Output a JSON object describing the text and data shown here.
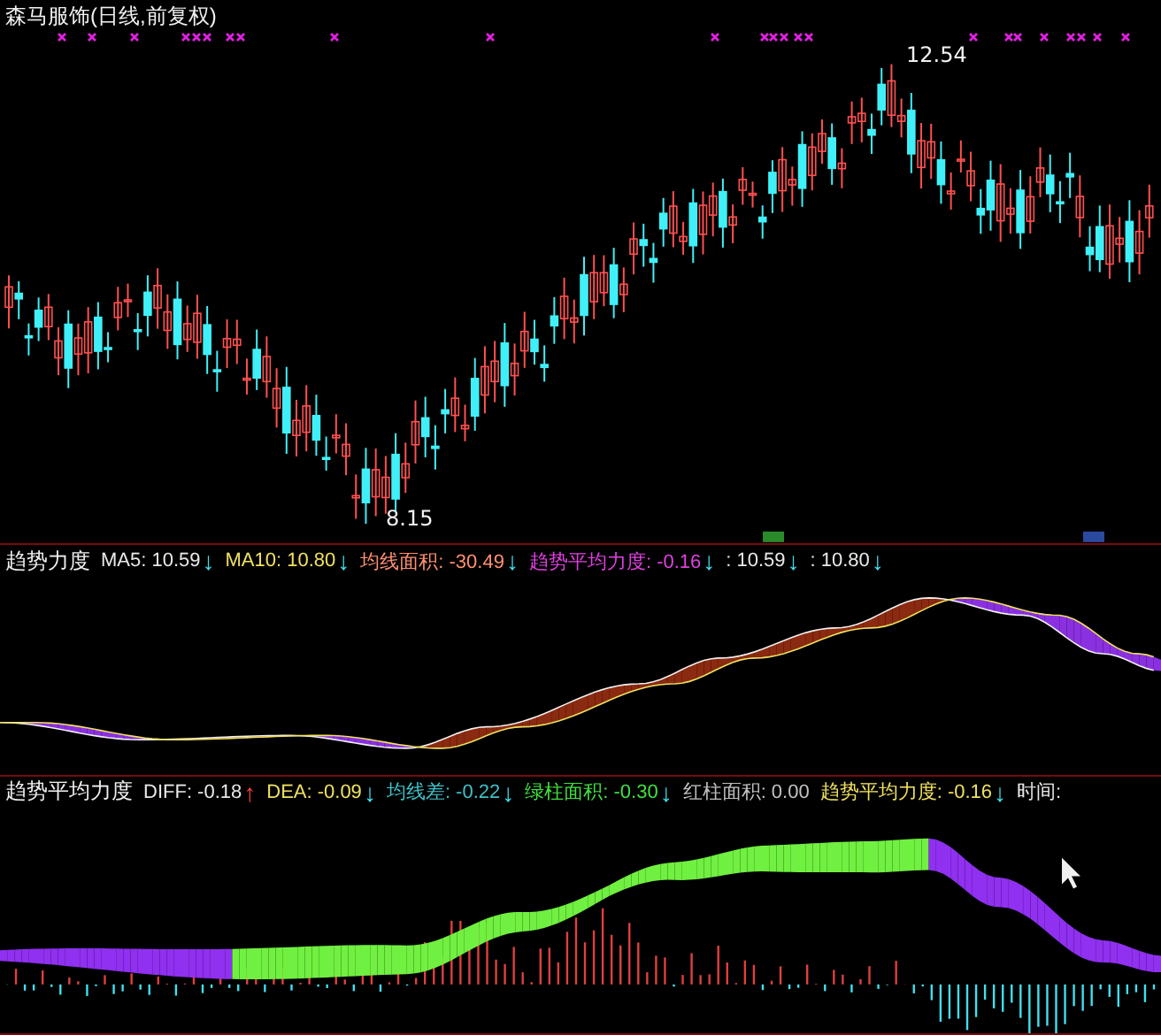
{
  "price_panel": {
    "title": "森马服饰(日线,前复权)",
    "high_label": "12.54",
    "low_label": "8.15"
  },
  "trend_panel": {
    "name": "趋势力度",
    "readings": [
      {
        "text": "MA5: 10.59",
        "color": "#e8e8e8",
        "arrow": {
          "text": "↓",
          "color": "#40e0f0"
        }
      },
      {
        "text": "MA10: 10.80",
        "color": "#f0e060",
        "arrow": {
          "text": "↓",
          "color": "#40e0f0"
        }
      },
      {
        "text": "均线面积: -30.49",
        "color": "#ff9070",
        "arrow": {
          "text": "↓",
          "color": "#40e0f0"
        }
      },
      {
        "text": "趋势平均力度: -0.16",
        "color": "#e040e0",
        "arrow": {
          "text": "↓",
          "color": "#40e0f0"
        }
      },
      {
        "text": ": 10.59",
        "color": "#e8e8e8",
        "arrow": {
          "text": "↓",
          "color": "#40e0f0"
        }
      },
      {
        "text": ": 10.80",
        "color": "#e8e8e8",
        "arrow": {
          "text": "↓",
          "color": "#40e0f0"
        }
      }
    ]
  },
  "macd_panel": {
    "name": "趋势平均力度",
    "readings": [
      {
        "text": "DIFF: -0.18",
        "color": "#e8e8e8",
        "arrow": {
          "text": "↑",
          "color": "#ff4040"
        }
      },
      {
        "text": "DEA: -0.09",
        "color": "#f0e060",
        "arrow": {
          "text": "↓",
          "color": "#40e0f0"
        }
      },
      {
        "text": "均线差: -0.22",
        "color": "#40c0c8",
        "arrow": {
          "text": "↓",
          "color": "#40e0f0"
        }
      },
      {
        "text": "绿柱面积: -0.30",
        "color": "#40e040",
        "arrow": {
          "text": "↓",
          "color": "#40e0f0"
        }
      },
      {
        "text": "红柱面积: 0.00",
        "color": "#c0c0c0"
      },
      {
        "text": "趋势平均力度: -0.16",
        "color": "#f0e060",
        "arrow": {
          "text": "↓",
          "color": "#40e0f0"
        }
      },
      {
        "text": "时间:",
        "color": "#e8e8e8"
      }
    ]
  }
}
